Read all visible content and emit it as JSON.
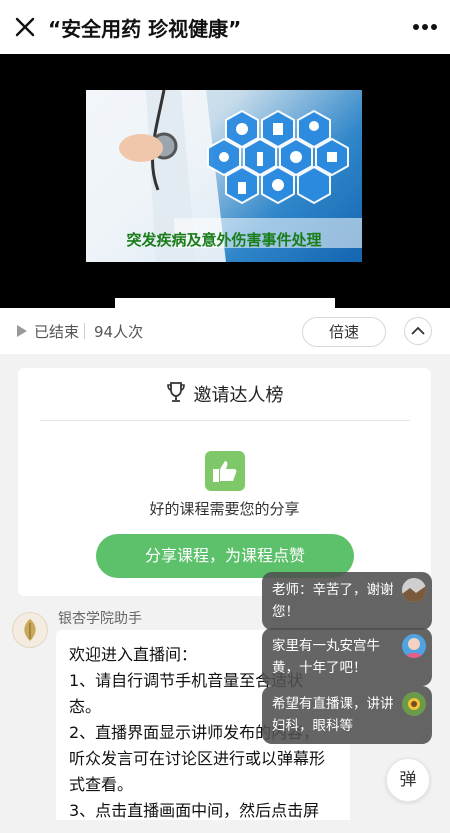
{
  "nav": {
    "title": "“安全用药 珍视健康”",
    "close_icon": "close-icon",
    "more_icon": "more-dots-icon"
  },
  "video": {
    "caption": "突发疾病及意外伤害事件处理",
    "scene_icons": [
      "hexagon-medical-icons"
    ]
  },
  "status": {
    "state": "已结束",
    "views": "94人次",
    "speed_label": "倍速",
    "collapse_icon": "chevron-up-icon"
  },
  "invite": {
    "title": "邀请达人榜",
    "trophy_icon": "trophy-icon",
    "thumb_icon": "thumbs-up-icon",
    "share_text": "好的课程需要您的分享",
    "share_button": "分享课程，为课程点赞"
  },
  "chat": {
    "sender": "银杏学院助手",
    "lines": [
      "欢迎进入直播间：",
      "1、请自行调节手机音量至合适状",
      "态。",
      "2、直播界面显示讲师发布的内容，",
      "听众发言可在讨论区进行或以弹幕形",
      "式查看。",
      "3、点击直播画面中间，然后点击屏"
    ]
  },
  "danmaku": [
    {
      "text": "老师：辛苦了，谢谢您！"
    },
    {
      "text": "家里有一丸安宫牛黄，十年了吧！"
    },
    {
      "text": "希望有直播课，讲讲妇科，眼科等"
    }
  ],
  "float_button": "弹",
  "colors": {
    "accent_green": "#5cc16a",
    "caption_green": "#1a7d1a",
    "danmaku_bg": "#505050"
  }
}
